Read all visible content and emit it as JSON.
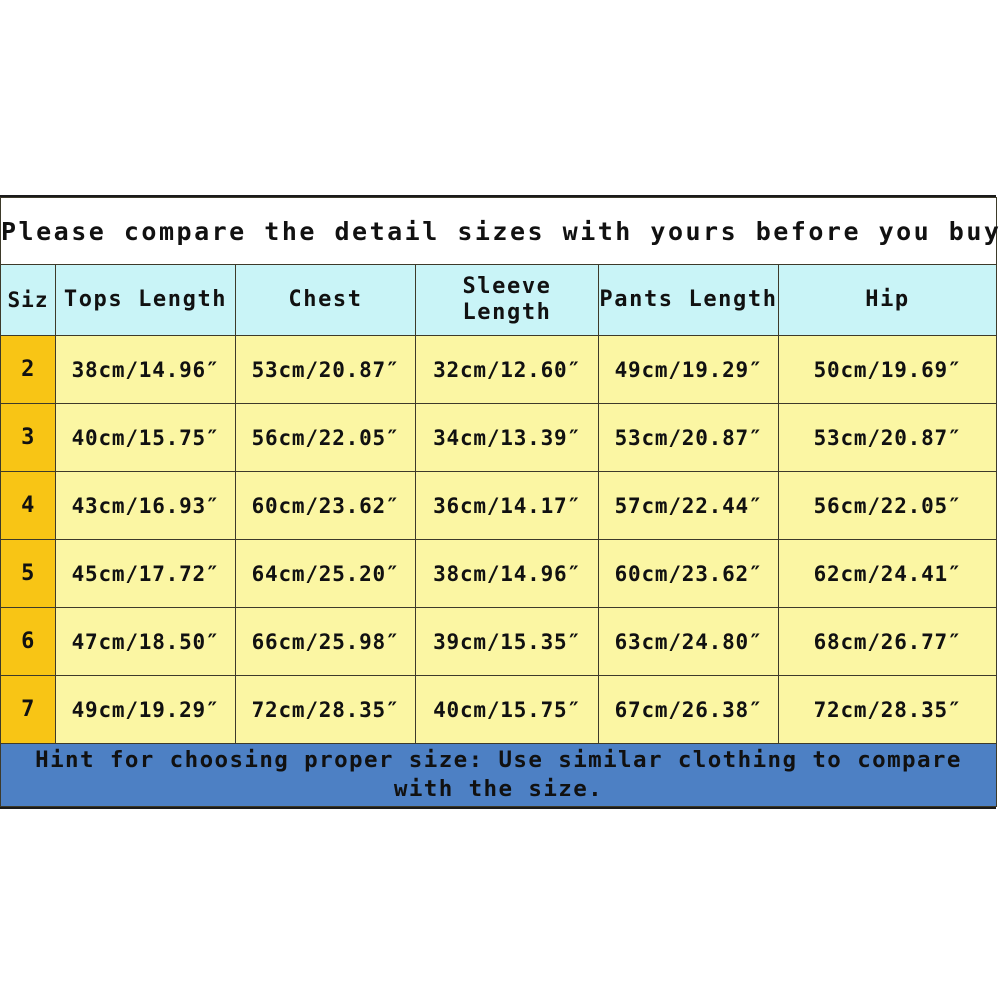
{
  "chart_data": {
    "type": "table",
    "title": "Please compare the detail sizes with yours before you buy",
    "columns": [
      "Siz",
      "Tops Length",
      "Chest",
      "Sleeve Length",
      "Pants Length",
      "Hip"
    ],
    "rows": [
      {
        "size": "2",
        "tops_length": "38cm/14.96″",
        "chest": "53cm/20.87″",
        "sleeve_length": "32cm/12.60″",
        "pants_length": "49cm/19.29″",
        "hip": "50cm/19.69″"
      },
      {
        "size": "3",
        "tops_length": "40cm/15.75″",
        "chest": "56cm/22.05″",
        "sleeve_length": "34cm/13.39″",
        "pants_length": "53cm/20.87″",
        "hip": "53cm/20.87″"
      },
      {
        "size": "4",
        "tops_length": "43cm/16.93″",
        "chest": "60cm/23.62″",
        "sleeve_length": "36cm/14.17″",
        "pants_length": "57cm/22.44″",
        "hip": "56cm/22.05″"
      },
      {
        "size": "5",
        "tops_length": "45cm/17.72″",
        "chest": "64cm/25.20″",
        "sleeve_length": "38cm/14.96″",
        "pants_length": "60cm/23.62″",
        "hip": "62cm/24.41″"
      },
      {
        "size": "6",
        "tops_length": "47cm/18.50″",
        "chest": "66cm/25.98″",
        "sleeve_length": "39cm/15.35″",
        "pants_length": "63cm/24.80″",
        "hip": "68cm/26.77″"
      },
      {
        "size": "7",
        "tops_length": "49cm/19.29″",
        "chest": "72cm/28.35″",
        "sleeve_length": "40cm/15.75″",
        "pants_length": "67cm/26.38″",
        "hip": "72cm/28.35″"
      }
    ],
    "footer_note": "Hint for choosing proper size: Use similar clothing to compare with the size.",
    "colors": {
      "title_background": "#ffffff",
      "header_background": "#c9f4f7",
      "size_column_background": "#f8c515",
      "data_cell_background": "#fbf6a3",
      "footer_background": "#4d80c4",
      "border": "#3d3a2a",
      "text": "#111111"
    }
  },
  "header": {
    "size_label": "Siz",
    "tops_length_label": "Tops Length",
    "chest_label": "Chest",
    "sleeve_label_line1": "Sleeve",
    "sleeve_label_line2": "Length",
    "pants_length_label": "Pants Length",
    "hip_label": "Hip"
  },
  "title": "Please compare the detail sizes with yours before you buy",
  "footer": {
    "hint": "Hint for choosing proper size: Use similar clothing to compare with the size."
  }
}
